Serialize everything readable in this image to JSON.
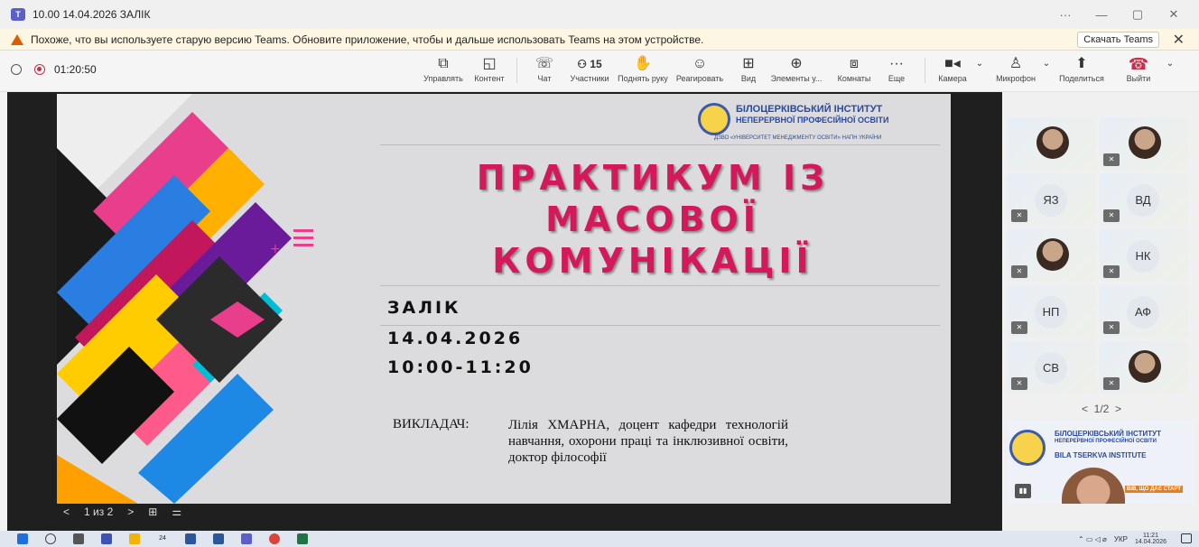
{
  "window": {
    "title": "10.00 14.04.2026 ЗАЛІК",
    "controls": [
      "···",
      "—",
      "▢",
      "✕"
    ]
  },
  "banner": {
    "message": "Похоже, что вы используете старую версию Teams. Обновите приложение, чтобы и дальше использовать Teams на этом устройстве.",
    "update_button": "Скачать Teams",
    "close": "✕"
  },
  "toolbar": {
    "timer": "01:20:50",
    "tools": [
      {
        "id": "share-control",
        "label": "Управлять",
        "icon": "⧉"
      },
      {
        "id": "content",
        "label": "Контент",
        "icon": "◱"
      },
      {
        "id": "chat",
        "label": "Чат",
        "icon": "💬"
      },
      {
        "id": "participants",
        "label": "Участники",
        "icon": "👥15"
      },
      {
        "id": "raise-hand",
        "label": "Поднять руку",
        "icon": "✋"
      },
      {
        "id": "react",
        "label": "Реагировать",
        "icon": "☺"
      },
      {
        "id": "view",
        "label": "Вид",
        "icon": "⊞"
      },
      {
        "id": "apps",
        "label": "Элементы у...",
        "icon": "⊕"
      },
      {
        "id": "rooms",
        "label": "Комнаты",
        "icon": "⧈"
      },
      {
        "id": "more",
        "label": "Еще",
        "icon": "···"
      },
      {
        "id": "camera",
        "label": "Камера",
        "icon": "■"
      },
      {
        "id": "mic",
        "label": "Микрофон",
        "icon": "🎙"
      },
      {
        "id": "share",
        "label": "Поделиться",
        "icon": "⬆"
      },
      {
        "id": "leave",
        "label": "Выйти",
        "icon": "☎"
      }
    ],
    "participant_count": "15"
  },
  "slide": {
    "logo_line1": "БІЛОЦЕРКІВСЬКИЙ ІНСТИТУТ",
    "logo_line2": "НЕПЕРЕРВНОЇ ПРОФЕСІЙНОЇ ОСВІТИ",
    "logo_line3": "ДЗВО «УНІВЕРСИТЕТ МЕНЕДЖМЕНТУ ОСВІТИ» НАПН УКРАЇНИ",
    "title_line1": "ПРАКТИКУМ ІЗ",
    "title_line2": "МАСОВОЇ",
    "title_line3": "КОМУНІКАЦІЇ",
    "info_line1": "ЗАЛІК",
    "info_line2": "14.04.2026",
    "info_line3": "10:00-11:20",
    "lecturer_label": "ВИКЛАДАЧ:",
    "lecturer_text": "Лілія ХМАРНА, доцент кафедри технологій навчання, охорони праці та інклюзивної освіти, доктор філософії",
    "accent_color": "#d4185c"
  },
  "slide_nav": {
    "prev": "<",
    "page": "1 из 2",
    "next": ">",
    "grid": "⊞",
    "settings": "⚌"
  },
  "participants": [
    {
      "initials": "",
      "photo": true,
      "muted": false
    },
    {
      "initials": "",
      "photo": true,
      "muted": true
    },
    {
      "initials": "ЯЗ",
      "photo": false,
      "muted": true
    },
    {
      "initials": "ВД",
      "photo": false,
      "muted": true
    },
    {
      "initials": "",
      "photo": true,
      "muted": true
    },
    {
      "initials": "НК",
      "photo": false,
      "muted": true
    },
    {
      "initials": "НП",
      "photo": false,
      "muted": true
    },
    {
      "initials": "АФ",
      "photo": false,
      "muted": true
    },
    {
      "initials": "СВ",
      "photo": false,
      "muted": true
    },
    {
      "initials": "",
      "photo": true,
      "muted": true
    }
  ],
  "pager": {
    "prev": "<",
    "label": "1/2",
    "next": ">"
  },
  "self_view": {
    "line1": "БІЛОЦЕРКІВСЬКИЙ ІНСТИТУТ",
    "line2": "НЕПЕРЕРВНОЇ ПРОФЕСІЙНОЇ ОСВІТИ",
    "line3": "BILA TSERKVA INSTITUTE",
    "caption": "ВІВ, ЩО ДАЄ СТАРТ"
  },
  "taskbar": {
    "badge": "24",
    "lang": "УКР",
    "time": "11:21",
    "date": "14.04.2026"
  }
}
